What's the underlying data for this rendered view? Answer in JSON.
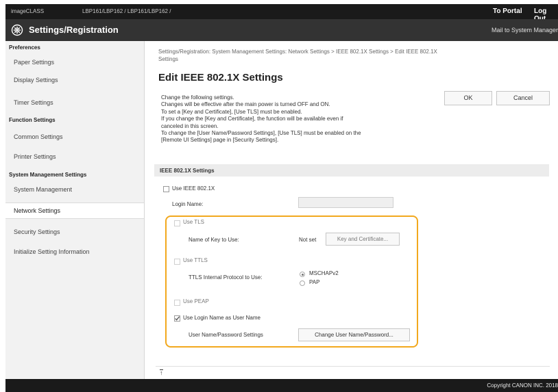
{
  "topbar": {
    "device_name": "imageCLASS",
    "device_path": "LBP161/LBP162 / LBP161/LBP162 /",
    "portal_label": "To Portal",
    "logout_label": "Log Out"
  },
  "header": {
    "title": "Settings/Registration",
    "mail_link": "Mail to System Manager"
  },
  "sidebar": {
    "groups": {
      "preferences": "Preferences",
      "function": "Function Settings",
      "system": "System Management Settings"
    },
    "items": {
      "paper": "Paper Settings",
      "display": "Display Settings",
      "timer": "Timer Settings",
      "common": "Common Settings",
      "printer": "Printer Settings",
      "system_mgmt": "System Management",
      "network": "Network Settings",
      "security": "Security Settings",
      "initialize": "Initialize Setting Information"
    }
  },
  "breadcrumb": {
    "line1": "Settings/Registration: System Management Settings: Network Settings > IEEE 802.1X Settings > Edit IEEE 802.1X",
    "line2": "Settings"
  },
  "page_title": "Edit IEEE 802.1X Settings",
  "instructions": [
    "Change the following settings.",
    "Changes will be effective after the main power is turned OFF and ON.",
    "To set a [Key and Certificate], [Use TLS] must be enabled.",
    "If you change the [Key and Certificate], the function will be available even if",
    "canceled in this screen.",
    "To change the [User Name/Password Settings], [Use TLS] must be enabled on the",
    "[Remote UI Settings] page in [Security Settings]."
  ],
  "buttons": {
    "ok": "OK",
    "cancel": "Cancel",
    "key_cert": "Key and Certificate...",
    "change_user": "Change User Name/Password..."
  },
  "section_title": "IEEE 802.1X Settings",
  "form": {
    "use_ieee": "Use IEEE 802.1X",
    "login_name_label": "Login Name:",
    "login_name_value": "",
    "use_tls": "Use TLS",
    "key_label": "Name of Key to Use:",
    "key_value": "Not set",
    "use_ttls": "Use TTLS",
    "ttls_label": "TTLS Internal Protocol to Use:",
    "ttls_options": [
      "MSCHAPv2",
      "PAP"
    ],
    "ttls_selected": "MSCHAPv2",
    "use_peap": "Use PEAP",
    "use_login_as_user": "Use Login Name as User Name",
    "use_login_as_user_checked": true,
    "user_pw_label": "User Name/Password Settings"
  },
  "page_top_link": "↑",
  "footer": {
    "copyright": "Copyright CANON INC. 2018"
  },
  "colors": {
    "highlight": "#f2a81d",
    "header_bg": "#333333",
    "topbar_bg": "#1a1a1a"
  }
}
